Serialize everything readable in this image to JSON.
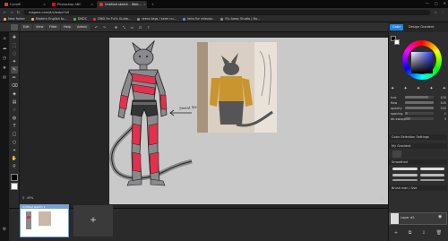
{
  "browser": {
    "tabs": [
      {
        "label": "Cyclo8"
      },
      {
        "label": "Photoshop ABC"
      },
      {
        "label": "Untitled sketch - Web..."
      }
    ],
    "url": "magma.com/d/c/bubo7n9",
    "bookmarks": [
      "New folder",
      "Modern English to...",
      "DNDC",
      "DND 5e Ful's Guide...",
      "dress tags / semi nu...",
      "links for relevan..",
      "Fly Away Studio | Bo..."
    ]
  },
  "app_menu": {
    "items": [
      "Edit",
      "View",
      "Filter",
      "Help",
      "Admin"
    ],
    "window_buttons": [
      "—",
      "▢",
      "✕"
    ]
  },
  "canvas": {
    "annotation": "Sweat Wrist Bands",
    "zoom": "49%"
  },
  "filmstrip": {
    "thumb_title": "Untitled sketch 1",
    "add_label": "+"
  },
  "right_panel": {
    "tabs": [
      "Color",
      "Design Gradient"
    ],
    "props": [
      {
        "label": "hue",
        "value": "100",
        "level": 0.8
      },
      {
        "label": "flow",
        "value": "100",
        "level": 1.0
      },
      {
        "label": "opacity",
        "value": "100",
        "level": 1.0
      },
      {
        "label": "spacing",
        "value": "1",
        "level": 0.1
      },
      {
        "label": "de-swapped",
        "value": "3",
        "level": 0.2
      }
    ],
    "sections": [
      "Color Selection Settings",
      "My Gradient",
      "Smoothed",
      "Brush own / Use"
    ],
    "layer_name": "Layer #1"
  },
  "colors": {
    "accent": "#1e88e5",
    "band": "#e0314d",
    "cat": "#8a8a8d"
  }
}
